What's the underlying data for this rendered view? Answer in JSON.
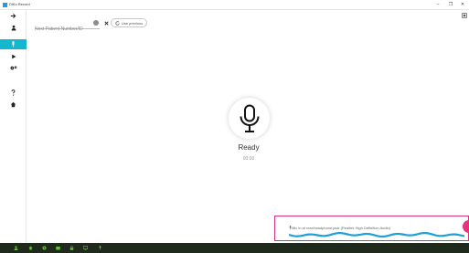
{
  "window": {
    "title": "DiKo Record"
  },
  "window_controls": {
    "minimize": "–",
    "maximize": "❐",
    "close": "✕"
  },
  "sidebar": {
    "items": [
      {
        "name": "logout",
        "icon": "arrow-right-icon"
      },
      {
        "name": "user",
        "icon": "user-icon"
      },
      {
        "name": "microphone",
        "icon": "microphone-icon",
        "active": true
      },
      {
        "name": "play",
        "icon": "play-icon"
      },
      {
        "name": "settings",
        "icon": "gears-icon"
      },
      {
        "name": "help",
        "icon": "question-icon"
      },
      {
        "name": "home",
        "icon": "home-icon"
      }
    ]
  },
  "patient": {
    "placeholder": "Next Patient Number/ID",
    "value": "",
    "use_previous_label": "Use previous"
  },
  "recorder": {
    "status": "Ready",
    "time": "00:00"
  },
  "audio": {
    "device_label": "Mic in at rear/headphone jack (Realtek High Definition Audio)"
  },
  "colors": {
    "accent": "#15b7cf",
    "record": "#e5347c",
    "panel_border": "#d2357e",
    "waveform": "#1e9fd8",
    "taskbar": "#1f2a1c",
    "taskbar_icons": "#5fc232"
  }
}
